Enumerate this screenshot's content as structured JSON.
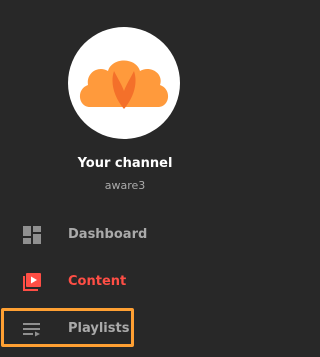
{
  "channel": {
    "title": "Your channel",
    "handle": "aware3"
  },
  "nav": {
    "items": [
      {
        "label": "Dashboard",
        "icon": "dashboard-icon",
        "active": false
      },
      {
        "label": "Content",
        "icon": "content-icon",
        "active": true
      },
      {
        "label": "Playlists",
        "icon": "playlists-icon",
        "active": false
      }
    ]
  },
  "colors": {
    "background": "#282828",
    "avatar_bg": "#ffffff",
    "avatar_logo": "#ff9a3c",
    "active_accent": "#ff4e45",
    "inactive_text": "#aaaaaa",
    "highlight_border": "#ffa033"
  }
}
